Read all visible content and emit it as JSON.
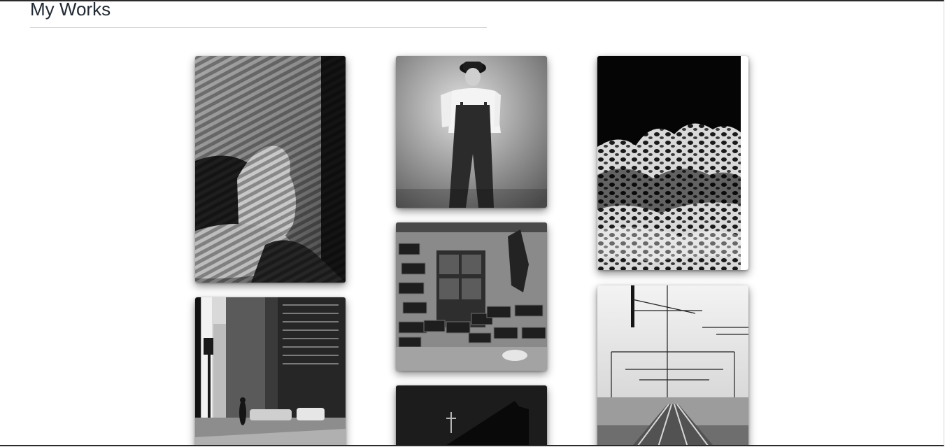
{
  "section": {
    "title": "My Works"
  },
  "gallery": {
    "items": [
      {
        "subject": "hands-blinds-shadow-photo"
      },
      {
        "subject": "person-overalls-bucket-hat-photo"
      },
      {
        "subject": "ocean-wave-foam-photo"
      },
      {
        "subject": "city-street-skyscrapers-photo"
      },
      {
        "subject": "concrete-block-wall-window-photo"
      },
      {
        "subject": "dark-building-cross-photo"
      },
      {
        "subject": "railway-tracks-overhead-lines-photo"
      }
    ]
  }
}
